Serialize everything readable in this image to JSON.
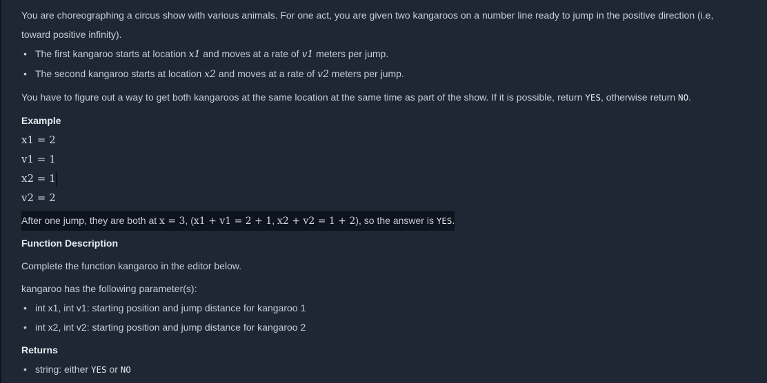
{
  "intro": {
    "line1": "You are choreographing a circus show with various animals. For one act, you are given two kangaroos on a number line ready to jump in the positive direction (i.e,",
    "line2": "toward positive infinity)."
  },
  "kangaroo_bullets": [
    {
      "prefix": "The first kangaroo starts at location ",
      "var1": "x1",
      "mid": " and moves at a rate of ",
      "var2": "v1",
      "suffix": " meters per jump."
    },
    {
      "prefix": "The second kangaroo starts at location ",
      "var1": "x2",
      "mid": " and moves at a rate of ",
      "var2": "v2",
      "suffix": " meters per jump."
    }
  ],
  "task": {
    "text": "You have to figure out a way to get both kangaroos at the same location at the same time as part of the show. If it is possible, return ",
    "yes": "YES",
    "middle": ", otherwise return ",
    "no": "NO",
    "end": "."
  },
  "example": {
    "heading": "Example",
    "lines": [
      "x1 = 2",
      "v1 = 1",
      "x2 = 1",
      "v2 = 2"
    ],
    "after": {
      "prefix": "After one jump, they are both at ",
      "eq1": "x = 3",
      "sep1": ", (",
      "eq2": "x1 + v1 = 2 + 1",
      "sep2": ", ",
      "eq3": "x2 + v2 = 1 + 2",
      "sep3": "), so the answer is ",
      "answer": "YES",
      "end": "."
    }
  },
  "function_description": {
    "heading": "Function Description",
    "text1": "Complete the function kangaroo in the editor below.",
    "text2": "kangaroo has the following parameter(s):",
    "params": [
      "int x1, int v1: starting position and jump distance for kangaroo 1",
      "int x2, int v2: starting position and jump distance for kangaroo 2"
    ]
  },
  "returns": {
    "heading": "Returns",
    "prefix": "string: either ",
    "yes": "YES",
    "or": " or ",
    "no": "NO"
  },
  "colors": {
    "background": "#1e2733",
    "text": "#c5ccd6",
    "highlight": "#0e141e"
  }
}
